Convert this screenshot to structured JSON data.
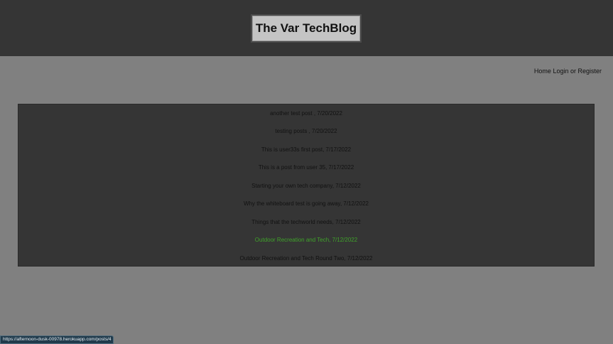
{
  "header": {
    "title": "The Var TechBlog"
  },
  "nav": {
    "home": "Home",
    "login_or_register": "Login or Register"
  },
  "posts": [
    {
      "text": "another test post , 7/20/2022"
    },
    {
      "text": "testing posts , 7/20/2022"
    },
    {
      "text": "This is user33s first post, 7/17/2022"
    },
    {
      "text": "This is a post from user 35, 7/17/2022"
    },
    {
      "text": "Starting your own tech company, 7/12/2022"
    },
    {
      "text": "Why the whiteboard test is going away, 7/12/2022"
    },
    {
      "text": "Things that the techworld needs, 7/12/2022"
    },
    {
      "text": "Outdoor Recreation and Tech, 7/12/2022",
      "hovered": true
    },
    {
      "text": "Outdoor Recreation and Tech Round Two, 7/12/2022"
    }
  ],
  "status_bar": {
    "url": "https://afternoon-dusk-00978.herokuapp.com/posts/4"
  },
  "colors": {
    "header_bg": "#353535",
    "page_bg": "#808080",
    "hover_link": "#3fa32a"
  }
}
